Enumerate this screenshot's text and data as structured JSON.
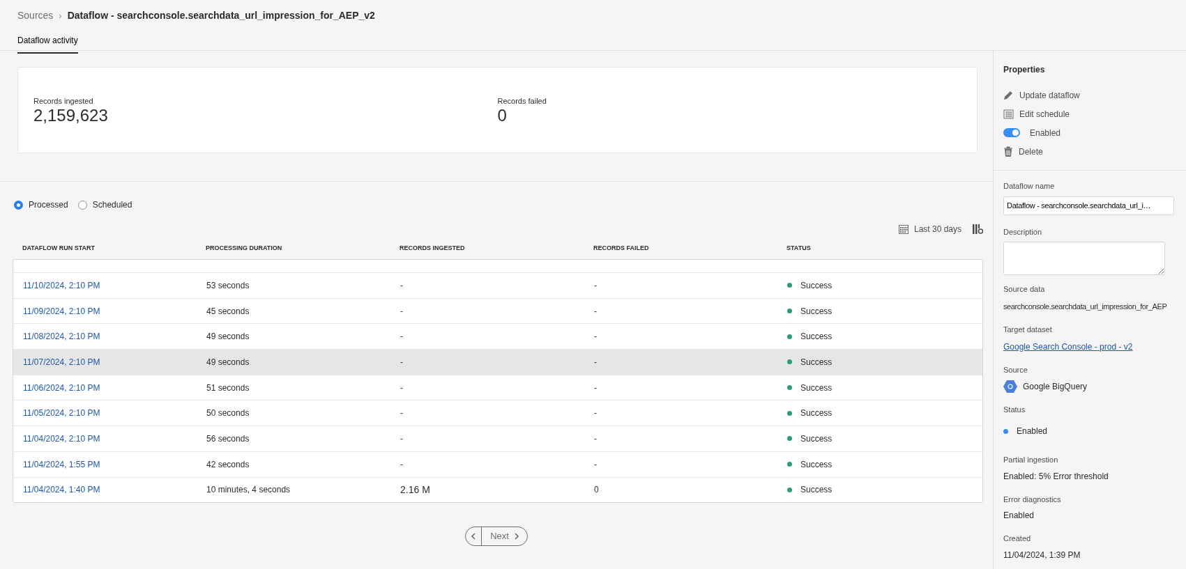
{
  "breadcrumb": {
    "parent": "Sources",
    "separator": "›",
    "current": "Dataflow - searchconsole.searchdata_url_impression_for_AEP_v2"
  },
  "tabs": [
    {
      "label": "Dataflow activity",
      "selected": true
    }
  ],
  "summary": [
    {
      "label": "Records ingested",
      "value": "2,159,623"
    },
    {
      "label": "Records failed",
      "value": "0"
    }
  ],
  "view_options": [
    {
      "label": "Processed",
      "selected": true
    },
    {
      "label": "Scheduled",
      "selected": false
    }
  ],
  "date_filter": "Last 30 days",
  "table": {
    "columns": [
      "DATAFLOW RUN START",
      "PROCESSING DURATION",
      "RECORDS INGESTED",
      "RECORDS FAILED",
      "STATUS"
    ],
    "rows": [
      {
        "start": "11/10/2024, 2:10 PM",
        "duration": "53 seconds",
        "ingested": "-",
        "failed": "-",
        "status": "Success",
        "color": "#2d9d78",
        "selected": false
      },
      {
        "start": "11/09/2024, 2:10 PM",
        "duration": "45 seconds",
        "ingested": "-",
        "failed": "-",
        "status": "Success",
        "color": "#2d9d78",
        "selected": false
      },
      {
        "start": "11/08/2024, 2:10 PM",
        "duration": "49 seconds",
        "ingested": "-",
        "failed": "-",
        "status": "Success",
        "color": "#2d9d78",
        "selected": false
      },
      {
        "start": "11/07/2024, 2:10 PM",
        "duration": "49 seconds",
        "ingested": "-",
        "failed": "-",
        "status": "Success",
        "color": "#2d9d78",
        "selected": true
      },
      {
        "start": "11/06/2024, 2:10 PM",
        "duration": "51 seconds",
        "ingested": "-",
        "failed": "-",
        "status": "Success",
        "color": "#2d9d78",
        "selected": false
      },
      {
        "start": "11/05/2024, 2:10 PM",
        "duration": "50 seconds",
        "ingested": "-",
        "failed": "-",
        "status": "Success",
        "color": "#2d9d78",
        "selected": false
      },
      {
        "start": "11/04/2024, 2:10 PM",
        "duration": "56 seconds",
        "ingested": "-",
        "failed": "-",
        "status": "Success",
        "color": "#2d9d78",
        "selected": false
      },
      {
        "start": "11/04/2024, 1:55 PM",
        "duration": "42 seconds",
        "ingested": "-",
        "failed": "-",
        "status": "Success",
        "color": "#2d9d78",
        "selected": false
      },
      {
        "start": "11/04/2024, 1:40 PM",
        "duration": "10 minutes, 4 seconds",
        "ingested": "2.16 M",
        "failed": "0",
        "status": "Success",
        "color": "#2d9d78",
        "selected": false
      }
    ]
  },
  "pagination": {
    "next": "Next"
  },
  "properties": {
    "title": "Properties",
    "actions": [
      {
        "kind": "pencil",
        "label": "Update dataflow"
      },
      {
        "kind": "calendar",
        "label": "Edit schedule"
      },
      {
        "kind": "toggle",
        "label": "Enabled",
        "on": true
      },
      {
        "kind": "trash",
        "label": "Delete"
      }
    ],
    "fields": [
      {
        "kind": "input",
        "label": "Dataflow name",
        "value": "Dataflow - searchconsole.searchdata_url_i…"
      },
      {
        "kind": "textarea",
        "label": "Description"
      },
      {
        "kind": "text",
        "label": "Source data",
        "value": "searchconsole.searchdata_url_impression_for_AEP"
      },
      {
        "kind": "link",
        "label": "Target dataset",
        "value": "Google Search Console - prod - v2"
      },
      {
        "kind": "source",
        "label": "Source",
        "value": "Google BigQuery"
      },
      {
        "kind": "status",
        "label": "Status",
        "value": "Enabled",
        "color": "#378ef0"
      },
      {
        "kind": "text",
        "label": "Partial ingestion",
        "value": "Enabled: 5% Error threshold"
      },
      {
        "kind": "text",
        "label": "Error diagnostics",
        "value": "Enabled"
      },
      {
        "kind": "text",
        "label": "Created",
        "value": "11/04/2024, 1:39 PM"
      }
    ]
  }
}
